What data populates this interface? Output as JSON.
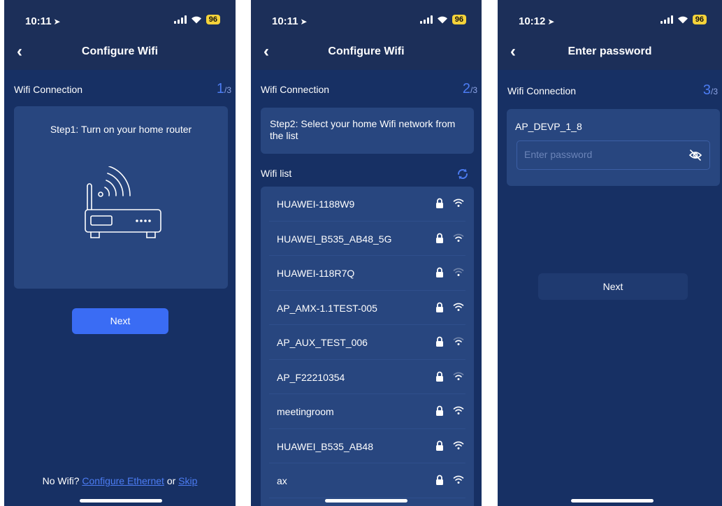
{
  "screens": [
    {
      "time": "10:11",
      "battery": "96",
      "title": "Configure Wifi",
      "section_label": "Wifi Connection",
      "step_current": "1",
      "step_total": "/3",
      "step_text": "Step1: Turn on your home router",
      "next_label": "Next",
      "footer_prefix": "No Wifi?",
      "footer_link_ethernet": "Configure Ethernet",
      "footer_or": "or",
      "footer_link_skip": "Skip"
    },
    {
      "time": "10:11",
      "battery": "96",
      "title": "Configure Wifi",
      "section_label": "Wifi Connection",
      "step_current": "2",
      "step_total": "/3",
      "step_text": "Step2: Select your home Wifi network from the list",
      "list_label": "Wifi list",
      "networks": [
        {
          "name": "HUAWEI-1188W9",
          "signal": "strong"
        },
        {
          "name": "HUAWEI_B535_AB48_5G",
          "signal": "medium"
        },
        {
          "name": "HUAWEI-118R7Q",
          "signal": "weak"
        },
        {
          "name": "AP_AMX-1.1TEST-005",
          "signal": "strong"
        },
        {
          "name": "AP_AUX_TEST_006",
          "signal": "medium"
        },
        {
          "name": "AP_F22210354",
          "signal": "medium"
        },
        {
          "name": "meetingroom",
          "signal": "strong"
        },
        {
          "name": "HUAWEI_B535_AB48",
          "signal": "strong"
        },
        {
          "name": "ax",
          "signal": "strong"
        }
      ]
    },
    {
      "time": "10:12",
      "battery": "96",
      "title": "Enter password",
      "section_label": "Wifi Connection",
      "step_current": "3",
      "step_total": "/3",
      "network_name": "AP_DEVP_1_8",
      "password_placeholder": "Enter password",
      "next_label": "Next"
    }
  ],
  "icons": {
    "location_arrow": "location-arrow-icon",
    "back": "chevron-left-icon",
    "refresh": "refresh-icon",
    "lock": "lock-icon",
    "wifi": "wifi-icon",
    "eye_off": "eye-slash-icon",
    "router": "router-illustration"
  },
  "colors": {
    "background": "#173064",
    "header": "#1c2f59",
    "card": "#28467f",
    "accent": "#3a6cf4",
    "step_number": "#4c7cf2",
    "battery": "#f5d33a"
  }
}
